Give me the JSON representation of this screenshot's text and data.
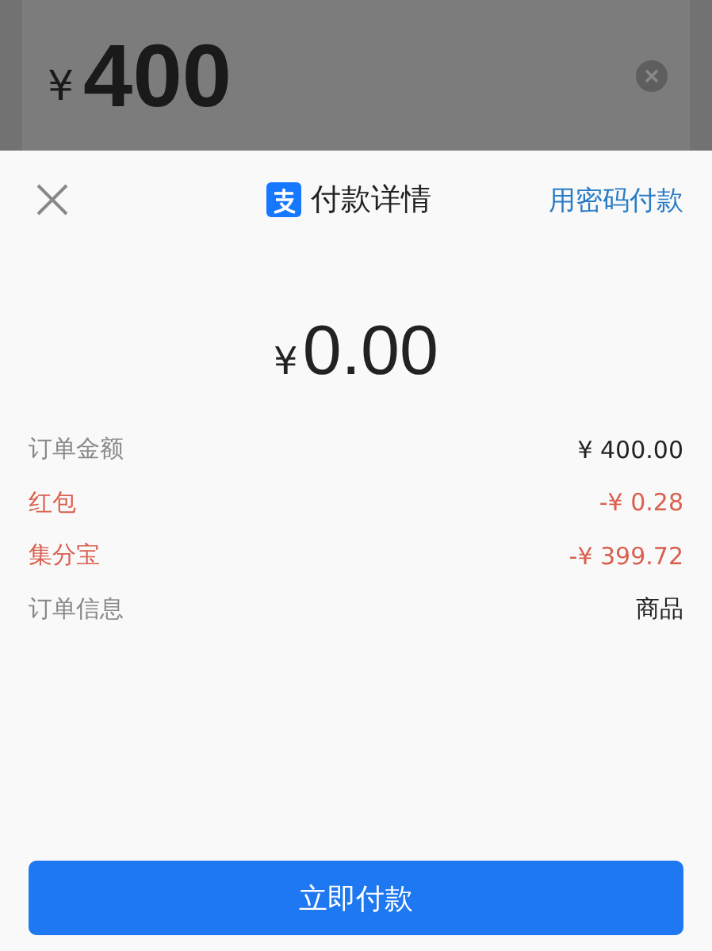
{
  "background_input": {
    "currency": "¥",
    "amount": "400"
  },
  "sheet": {
    "title": "付款详情",
    "alt_action": "用密码付款",
    "currency": "¥",
    "amount": "0.00",
    "rows": [
      {
        "label": "订单金额",
        "value": "¥ 400.00",
        "kind": "normal"
      },
      {
        "label": "红包",
        "value": "-¥ 0.28",
        "kind": "discount"
      },
      {
        "label": "集分宝",
        "value": "-¥ 399.72",
        "kind": "discount"
      },
      {
        "label": "订单信息",
        "value": "商品",
        "kind": "normal"
      }
    ],
    "pay_button": "立即付款"
  }
}
